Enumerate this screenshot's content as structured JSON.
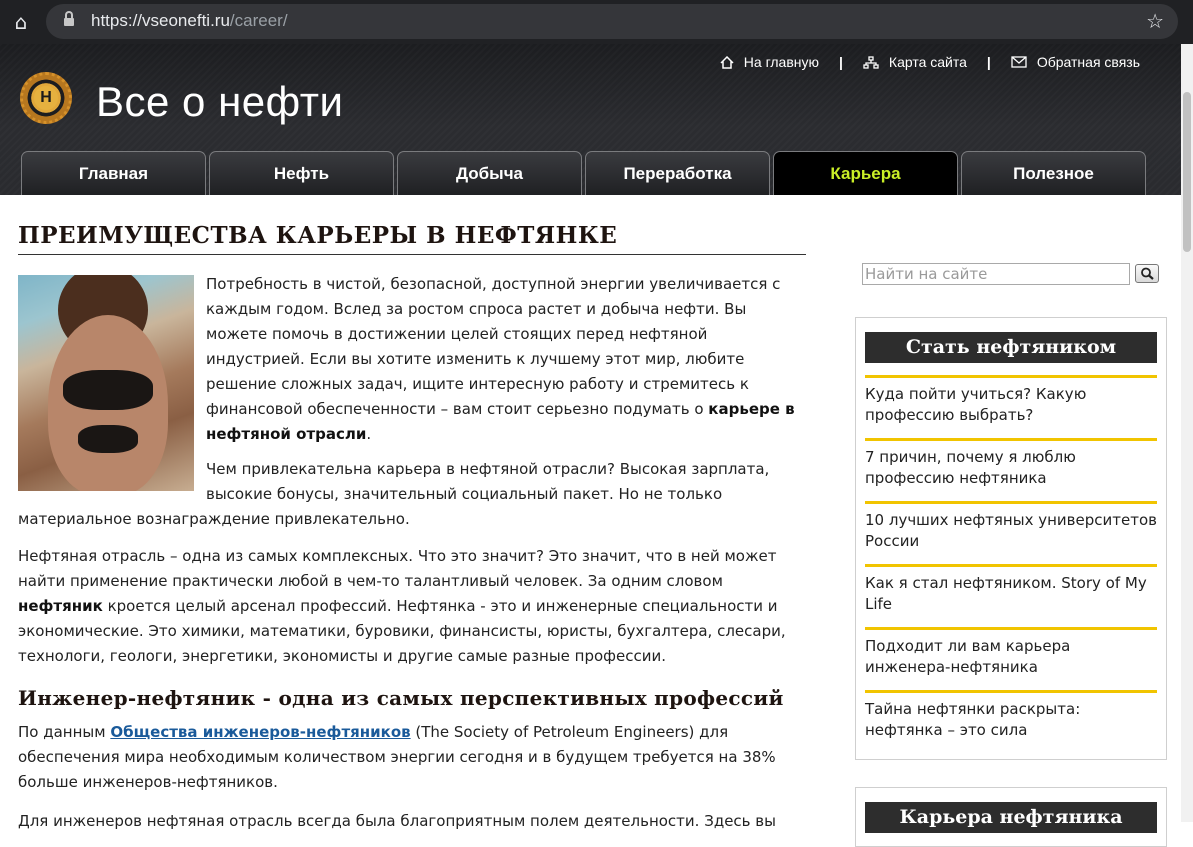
{
  "browser": {
    "url_host": "https://vseonefti.ru",
    "url_path": "/career/"
  },
  "header": {
    "logo_letter": "Н",
    "site_title": "Все о нефти",
    "links": [
      {
        "label": "На главную",
        "icon": "home-icon"
      },
      {
        "label": "Карта сайта",
        "icon": "sitemap-icon"
      },
      {
        "label": "Обратная связь",
        "icon": "mail-icon"
      }
    ],
    "separator": "|"
  },
  "nav": {
    "tabs": [
      "Главная",
      "Нефть",
      "Добыча",
      "Переработка",
      "Карьера",
      "Полезное"
    ],
    "active_tab": "Карьера",
    "active_color": "#c9ee27"
  },
  "article": {
    "title": "ПРЕИМУЩЕСТВА КАРЬЕРЫ В НЕФТЯНКЕ",
    "p1_text": "Потребность в чистой, безопасной, доступной энергии увеличивается с каждым годом. Вслед за ростом спроса растет и добыча нефти. Вы можете помочь в достижении целей стоящих перед нефтяной индустрией. Если вы хотите изменить к лучшему этот мир, любите решение сложных задач, ищите интересную работу и стремитесь к финансовой обеспеченности – вам стоит серьезно подумать о ",
    "p1_bold": "карьере в нефтяной отрасли",
    "p1_end": ".",
    "p2": "Чем привлекательна карьера в нефтяной отрасли? Высокая зарплата, высокие бонусы, значительный социальный пакет. Но не только материальное вознаграждение привлекательно.",
    "p3_start": "Нефтяная отрасль – одна из самых комплексных. Что это значит? Это значит, что в ней может найти применение практически любой в чем-то талантливый человек. За одним словом ",
    "p3_bold": "нефтяник",
    "p3_end": " кроется целый арсенал профессий. Нефтянка - это и инженерные специальности и экономические. Это химики, математики, буровики, финансисты, юристы, бухгалтера, слесари, технологи, геологи, энергетики, экономисты и другие самые разные профессии.",
    "h2": "Инженер-нефтяник - одна из самых перспективных профессий",
    "p4_start": "По данным ",
    "p4_link": "Общества инженеров-нефтяников",
    "p4_end": " (The Society of Petroleum Engineers) для обеспечения мира необходимым количеством энергии сегодня и в будущем требуется на 38% больше инженеров-нефтяников.",
    "p5": "Для инженеров нефтяная отрасль всегда была благоприятным полем деятельности. Здесь вы"
  },
  "sidebar": {
    "search_placeholder": "Найти на сайте",
    "widget1_title": "Стать нефтяником",
    "widget1_items": [
      "Куда пойти учиться? Какую профессию выбрать?",
      "7 причин, почему я люблю профессию нефтяника",
      "10 лучших нефтяных университетов России",
      "Как я стал нефтяником. Story of My Life",
      "Подходит ли вам карьера инженера-нефтяника",
      "Тайна нефтянки раскрыта: нефтянка – это сила"
    ],
    "widget2_title": "Карьера нефтяника",
    "accent_color": "#f1c400"
  }
}
